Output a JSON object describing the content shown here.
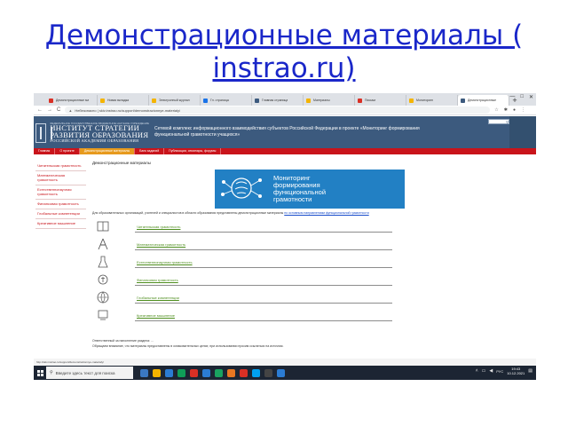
{
  "slide": {
    "title": "Демонстрационные материалы ( instrao.ru)"
  },
  "browser": {
    "tabs": [
      {
        "label": "Демонстрационные ма",
        "color": "#d93025"
      },
      {
        "label": "Новая вкладка",
        "color": "#f4b400"
      },
      {
        "label": "Электронный журнал",
        "color": "#f4b400"
      },
      {
        "label": "Гл. страница",
        "color": "#1a73e8"
      },
      {
        "label": "Главная страница",
        "color": "#3c5a7e"
      },
      {
        "label": "Материалы",
        "color": "#f4b400"
      },
      {
        "label": "Письма",
        "color": "#d93025"
      },
      {
        "label": "Мониторинг",
        "color": "#f4b400"
      },
      {
        "label": "Демонстрационные",
        "color": "#3c5a7e"
      }
    ],
    "new_tab": "+",
    "window_controls": {
      "minimize": "—",
      "maximize": "□",
      "close": "✕"
    },
    "url": "Небезопасно | skiv.instrao.ru/support/demonstrazionnye-materialy/",
    "nav": {
      "back": "←",
      "forward": "→",
      "reload": "C"
    }
  },
  "site": {
    "logo_top": "ФЕДЕРАЛЬНОЕ ГОСУДАРСТВЕННОЕ БЮДЖЕТНОЕ НАУЧНОЕ УЧРЕЖДЕНИЕ",
    "logo_lines": [
      "ИНСТИТУТ СТРАТЕГИИ",
      "РАЗВИТИЯ ОБРАЗОВАНИЯ",
      "РОССИЙСКОЙ АКАДЕМИИ ОБРАЗОВАНИЯ"
    ],
    "header_title": "Сетевой комплекс информационного взаимодействия субъектов Российской Федерации в проекте «Мониторинг формирования функциональной грамотности учащихся»",
    "menu": [
      {
        "label": "Главная"
      },
      {
        "label": "О проекте"
      },
      {
        "label": "Демонстрационные материалы",
        "active": true
      },
      {
        "label": "Банк заданий"
      },
      {
        "label": "Публикации, семинары, форумы"
      }
    ],
    "sidebar": [
      "Читательская грамотность",
      "Математическая грамотность",
      "Естественнонаучная грамотность",
      "Финансовая грамотность",
      "Глобальные компетенции",
      "Креативное мышление"
    ],
    "page_heading": "Демонстрационные материалы",
    "banner": {
      "line1": "Мониторинг",
      "line2": "формирования",
      "line3": "функциональной",
      "line4": "грамотности"
    },
    "intro": "Для образовательных организаций, учителей и специалистов в области образования представлены демонстрационные материалы",
    "intro_link": "по основным направлениям функциональной грамотности",
    "materials": [
      {
        "label": "Читательская грамотность"
      },
      {
        "label": "Математическая грамотность"
      },
      {
        "label": "Естественнонаучная грамотность"
      },
      {
        "label": "Финансовая грамотность"
      },
      {
        "label": "Глобальные компетенции"
      },
      {
        "label": "Креативное мышление"
      }
    ],
    "bottom_note_1": "Ответственный за наполнение раздела: ...",
    "bottom_note_2": "Обращаем внимание, что материалы предоставлены в ознакомительных целях; при использовании просим ссылаться на источник."
  },
  "status_bar": "http://skiv.instrao.ru/support/demonstrazionnye-materialy/",
  "taskbar": {
    "search_placeholder": "Введите здесь текст для поиска",
    "apps": [
      "#3a78c3",
      "#f4b400",
      "#2b7cd3",
      "#0f9d58",
      "#d93025",
      "#2b7cd3",
      "#1aa260",
      "#e87722",
      "#d93025",
      "#00a1f1",
      "#444444",
      "#2b7cd3"
    ],
    "time": "19:43",
    "date": "10.12.2021",
    "lang": "РУС"
  }
}
